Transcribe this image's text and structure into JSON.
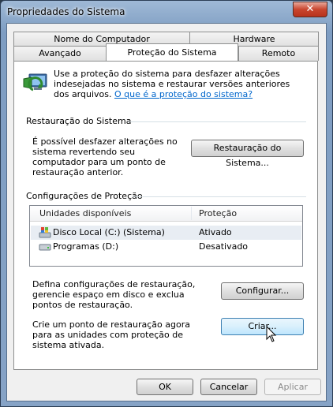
{
  "window": {
    "title": "Propriedades do Sistema",
    "close_label": "✕"
  },
  "tabs": {
    "row1": [
      "Nome do Computador",
      "Hardware"
    ],
    "row2": [
      "Avançado",
      "Proteção do Sistema",
      "Remoto"
    ],
    "selected": "Proteção do Sistema"
  },
  "intro": {
    "text": "Use a proteção do sistema para desfazer alterações indesejadas no sistema e restaurar versões anteriores dos arquivos.",
    "link": "O que é a proteção do sistema?"
  },
  "restore": {
    "heading": "Restauração do Sistema",
    "description": "É possível desfazer alterações no sistema revertendo seu computador para um ponto de restauração anterior.",
    "button": "Restauração do Sistema..."
  },
  "protection": {
    "heading": "Configurações de Proteção",
    "columns": [
      "Unidades disponíveis",
      "Proteção"
    ],
    "drives": [
      {
        "name": "Disco Local (C:) (Sistema)",
        "status": "Ativado",
        "icon": "system-drive-icon"
      },
      {
        "name": "Programas (D:)",
        "status": "Desativado",
        "icon": "drive-icon"
      }
    ],
    "configure_text": "Defina configurações de restauração, gerencie espaço em disco e exclua pontos de restauração.",
    "configure_button": "Configurar...",
    "create_text": "Crie um ponto de restauração agora para as unidades com proteção de sistema ativada.",
    "create_button": "Criar..."
  },
  "footer": {
    "ok": "OK",
    "cancel": "Cancelar",
    "apply": "Aplicar"
  }
}
